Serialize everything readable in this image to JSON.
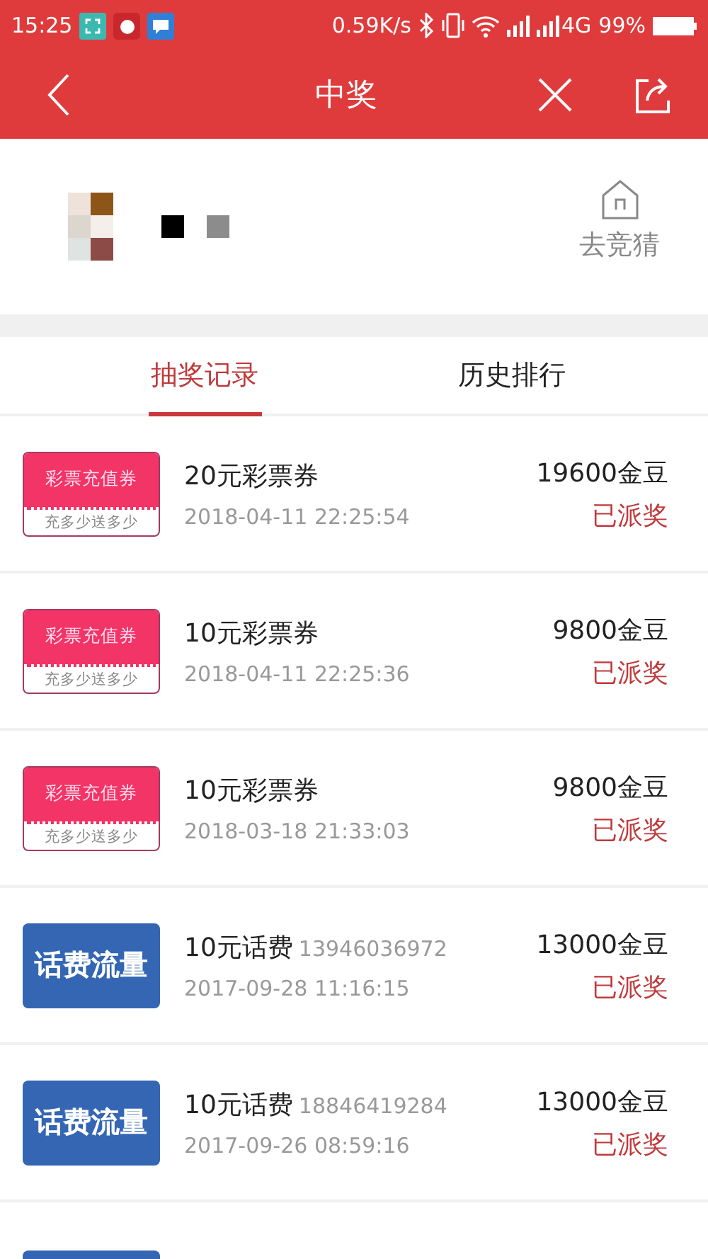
{
  "status_bar": {
    "time": "15:25",
    "speed": "0.59K/s",
    "network": "4G",
    "battery": "99%"
  },
  "nav": {
    "title": "中奖"
  },
  "profile": {
    "link": "去竞猜"
  },
  "tabs": [
    {
      "label": "抽奖记录",
      "selected": true
    },
    {
      "label": "历史排行",
      "selected": false
    }
  ],
  "records": [
    {
      "kind": "lottery",
      "badge_top": "彩票充值券",
      "badge_bottom": "充多少送多少",
      "title": "20元彩票券",
      "date": "2018-04-11 22:25:54",
      "amount": "19600金豆",
      "status": "已派奖"
    },
    {
      "kind": "lottery",
      "badge_top": "彩票充值券",
      "badge_bottom": "充多少送多少",
      "title": "10元彩票券",
      "date": "2018-04-11 22:25:36",
      "amount": "9800金豆",
      "status": "已派奖"
    },
    {
      "kind": "lottery",
      "badge_top": "彩票充值券",
      "badge_bottom": "充多少送多少",
      "title": "10元彩票券",
      "date": "2018-03-18 21:33:03",
      "amount": "9800金豆",
      "status": "已派奖"
    },
    {
      "kind": "phone",
      "badge_top": "话费流量",
      "title": "10元话费",
      "phone": "13946036972",
      "date": "2017-09-28 11:16:15",
      "amount": "13000金豆",
      "status": "已派奖"
    },
    {
      "kind": "phone",
      "badge_top": "话费流量",
      "title": "10元话费",
      "phone": "18846419284",
      "date": "2017-09-26 08:59:16",
      "amount": "13000金豆",
      "status": "已派奖"
    },
    {
      "kind": "phone_partial"
    }
  ]
}
